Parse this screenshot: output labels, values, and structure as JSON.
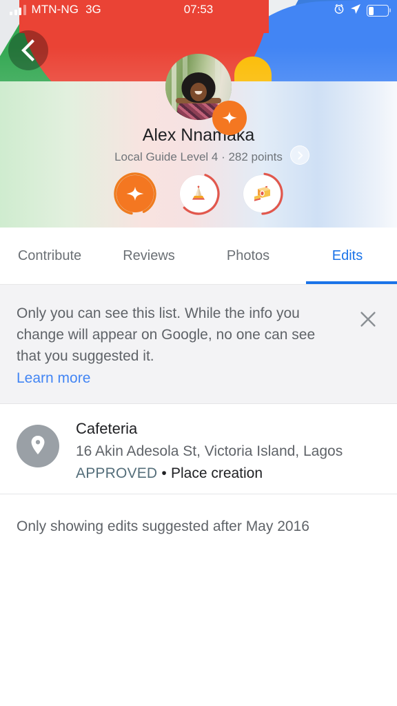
{
  "status_bar": {
    "carrier": "MTN-NG",
    "network": "3G",
    "time": "07:53",
    "signal_icon": "signal-bars-icon",
    "alarm_icon": "alarm-icon",
    "location_icon": "location-arrow-icon",
    "battery_icon": "battery-icon",
    "battery_level": "24%"
  },
  "header": {
    "back_icon": "back-arrow-icon",
    "banner_colors": {
      "red": "#ea4335",
      "green": "#34a853",
      "blue": "#4285f4",
      "yellow": "#fbbc05",
      "gray": "#eceff1"
    }
  },
  "profile": {
    "avatar_name": "avatar",
    "badge_icon": "local-guide-star-icon",
    "name": "Alex Nnamaka",
    "meta": "Local Guide Level 4 · 282 points",
    "level": "4",
    "points": "282",
    "chevron_icon": "chevron-right-icon",
    "badges": [
      {
        "name": "local-guide-star-badge",
        "icon": "star-icon",
        "ring_color": "#ef7c1f",
        "progress": 0.9
      },
      {
        "name": "edits-badge",
        "icon": "pencil-icon",
        "ring_color": "#e2574c",
        "progress": 0.55
      },
      {
        "name": "photos-badge",
        "icon": "camera-icon",
        "ring_color": "#e2574c",
        "progress": 0.45
      }
    ]
  },
  "tabs": {
    "items": [
      {
        "label": "Contribute",
        "active": false
      },
      {
        "label": "Reviews",
        "active": false
      },
      {
        "label": "Photos",
        "active": false
      },
      {
        "label": "Edits",
        "active": true
      }
    ],
    "active_color": "#1a73e8"
  },
  "notice": {
    "text": "Only you can see this list. While the info you change will appear on Google, no one can see that you suggested it.",
    "link": "Learn more",
    "close_icon": "close-icon",
    "link_color": "#4285f4"
  },
  "edits": {
    "items": [
      {
        "icon": "place-pin-icon",
        "title": "Cafeteria",
        "address": "16 Akin Adesola St, Victoria Island, Lagos",
        "status": "APPROVED",
        "separator": "•",
        "type": "Place creation",
        "status_color": "#546e7a"
      }
    ],
    "footer": "Only showing edits suggested after May 2016"
  }
}
